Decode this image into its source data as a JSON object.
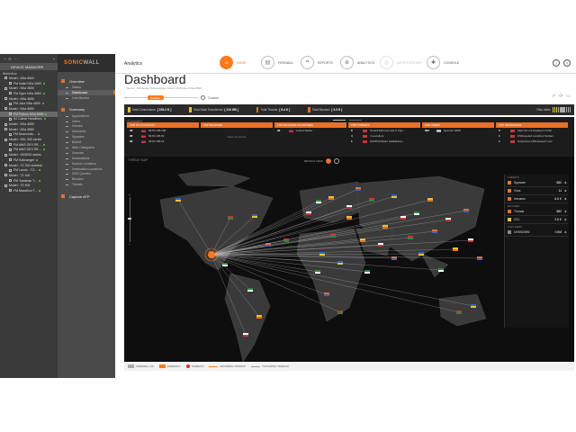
{
  "device_manager": {
    "header": "DEVICE MANAGER",
    "root": "WorkView",
    "nodes": [
      {
        "label": "Model : NSa 5600",
        "child": false,
        "selected": false
      },
      {
        "label": "FM Indiei NSa 2650",
        "child": true,
        "selected": false
      },
      {
        "label": "Model : NSa 3650",
        "child": false,
        "selected": false
      },
      {
        "label": "FM Viper NSa 3650",
        "child": true,
        "selected": false
      },
      {
        "label": "Model : NSa 4650",
        "child": false,
        "selected": false
      },
      {
        "label": "FM Jazz NSa 4650",
        "child": true,
        "selected": false
      },
      {
        "label": "Model : NSa 5650",
        "child": false,
        "selected": false
      },
      {
        "label": "FM Python NSa 5650",
        "child": true,
        "selected": true
      },
      {
        "label": "SJ Camel Headlines",
        "child": true,
        "selected": false
      },
      {
        "label": "Model : NSa 6650",
        "child": false,
        "selected": false
      },
      {
        "label": "Model : NSa 9650",
        "child": false,
        "selected": false
      },
      {
        "label": "FM Anaconda...",
        "child": true,
        "selected": false
      },
      {
        "label": "Model : NSv 300 series",
        "child": false,
        "selected": false
      },
      {
        "label": "FM AWS OEV RE...",
        "child": true,
        "selected": false
      },
      {
        "label": "FM AWS OEV RE...",
        "child": true,
        "selected": false
      },
      {
        "label": "Model : SM9200 series",
        "child": false,
        "selected": false
      },
      {
        "label": "FM Kattnaeger",
        "child": true,
        "selected": false
      },
      {
        "label": "Model : TZ 300 wireless",
        "child": false,
        "selected": false
      },
      {
        "label": "FM Lando - TZ...",
        "child": true,
        "selected": false
      },
      {
        "label": "Model : TZ 400",
        "child": false,
        "selected": false
      },
      {
        "label": "FM Toadman T...",
        "child": true,
        "selected": false
      },
      {
        "label": "Model : TZ 600",
        "child": false,
        "selected": false
      },
      {
        "label": "FM Marathon T...",
        "child": true,
        "selected": false
      }
    ]
  },
  "nav": {
    "logo_brand": "SONIC",
    "logo_rest": "WALL",
    "sections": [
      {
        "title": "Overview",
        "items": [
          "Status",
          "Dashboard",
          "Live Monitor"
        ],
        "active": 1
      },
      {
        "title": "Summary",
        "items": [
          "Applications",
          "Users",
          "Viruses",
          "Intrusions",
          "Spyware",
          "Botnet",
          "Web Categories",
          "Sources",
          "Destinations",
          "Source Locations",
          "Destination Locations",
          "SSO Queries",
          "Blocked",
          "Threats"
        ],
        "active": -1
      },
      {
        "title": "Capture ATP",
        "items": [],
        "active": -1
      }
    ]
  },
  "topbar": {
    "app_title": "Analytics",
    "nav": [
      {
        "label": "HOME",
        "icon": "home-icon",
        "glyph": "⌂"
      },
      {
        "label": "FIREWALL",
        "icon": "firewall-icon",
        "glyph": "▤"
      },
      {
        "label": "REPORTS",
        "icon": "reports-icon",
        "glyph": "⌗"
      },
      {
        "label": "ANALYTICS",
        "icon": "analytics-icon",
        "glyph": "⊕"
      },
      {
        "label": "NOTIFICATIONS",
        "icon": "notifications-icon",
        "glyph": "◎"
      },
      {
        "label": "CONSOLE",
        "icon": "console-icon",
        "glyph": "✱"
      }
    ],
    "right_icons": [
      "alerts-icon",
      "help-icon",
      "user-avatar"
    ],
    "avatar_text": "FM"
  },
  "page": {
    "title": "Dashboard",
    "breadcrumb": "↑ Tenant : FM Device Options/Zone Units / FM Python NSa 6650"
  },
  "timebar": {
    "slider_label": "Realtime",
    "mode": "Custom",
    "slider_position": 0.02
  },
  "stats": [
    {
      "label": "Total Connections",
      "value": "[ 376.2 K ]",
      "color": "#e8c23a"
    },
    {
      "label": "Total Data Transferred",
      "value": "[ 210 GB ]",
      "color": "#e8c23a"
    },
    {
      "label": "Total Threats",
      "value": "[ 6.4 K ]",
      "color": "#e8702a"
    },
    {
      "label": "Total Blocked",
      "value": "[ 3.3 K ]",
      "color": "#e8702a"
    }
  ],
  "risk_index": "Risk Index",
  "panel": {
    "title": "SUMMARY",
    "columns": [
      {
        "header": "TOP IP LOCATIONS",
        "rows": [
          {
            "n": "98",
            "flag": "us",
            "text": "99.84.108.108"
          },
          {
            "n": "98",
            "flag": "us",
            "text": "99.84.136.81"
          },
          {
            "n": "98",
            "flag": "us",
            "text": "99.84.155.21"
          }
        ]
      },
      {
        "header": "TOP BLOCKED",
        "rows": [],
        "empty": "Data not Found"
      },
      {
        "header": "TOP BLOCKED COUNTRIES",
        "rows": [
          {
            "n": "96",
            "flag": "us",
            "text": "United States"
          }
        ]
      },
      {
        "header": "TOP THREATS",
        "rows": [
          {
            "n": "8",
            "flag": "red",
            "text": "Ceued Retrouvé (HL-2 Ingo..."
          },
          {
            "n": "4",
            "flag": "red",
            "text": "m-excellent"
          },
          {
            "n": "1",
            "flag": "red",
            "text": "HAPPOHSLE2 (HaRaHus)..."
          }
        ]
      },
      {
        "header": "TOP USERS",
        "rows": [
          {
            "n": "882",
            "flag": "tri",
            "text": "Sponsor 6669"
          }
        ]
      },
      {
        "header": "TOP INTRUSIONS",
        "rows": [
          {
            "n": "5",
            "flag": "red",
            "text": "Filter 9s Lint Headed 2.0 Pai"
          },
          {
            "n": "1",
            "flag": "red",
            "text": "DSlinseeled Localized Softam"
          },
          {
            "n": "1",
            "flag": "red",
            "text": "Suspicious DSlinseeled Locs"
          }
        ]
      }
    ]
  },
  "map": {
    "title": "THREAT MAP",
    "details_label": "DETAILS VIEW",
    "right_panel": {
      "sections": [
        {
          "title": "THREATS",
          "rows": [
            {
              "label": "Spyware",
              "value": "882",
              "color": "#e8702a"
            },
            {
              "label": "Virus",
              "value": "11",
              "color": "#e8702a"
            },
            {
              "label": "Intrusion",
              "value": "6.6 K",
              "color": "#e8702a"
            }
          ]
        },
        {
          "title": "BLOCKED",
          "rows": [
            {
              "label": "Threats",
              "value": "882",
              "color": "#e8702a"
            },
            {
              "label": "GTL",
              "value": "2.8 K",
              "color": "#e8c23a"
            }
          ]
        },
        {
          "title": "TOP USERS",
          "rows": [
            {
              "label": "UNKNOWN",
              "value": "0.5M",
              "color": "#888"
            }
          ]
        }
      ]
    },
    "legend": [
      {
        "label": "FIREWALL",
        "kind": "fw"
      },
      {
        "label": "THREATS",
        "kind": "threat"
      },
      {
        "label": "INCOMING TRAFFIC",
        "kind": "in"
      },
      {
        "label": "OUTGOING TRAFFIC",
        "kind": "out"
      }
    ],
    "legend_prefix": "FIREWALL OF"
  },
  "colors": {
    "accent": "#ff7a1a",
    "orange": "#e8702a",
    "dark": "#1c1c1c"
  }
}
